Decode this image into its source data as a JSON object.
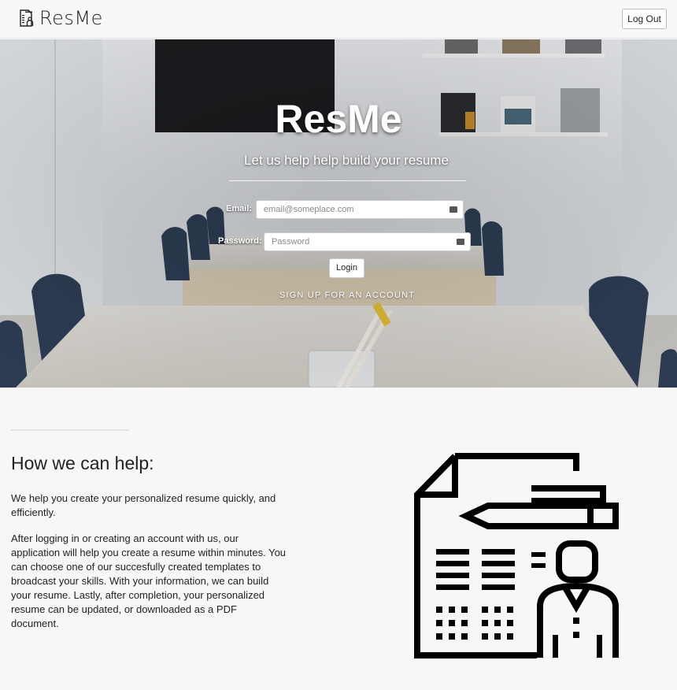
{
  "navbar": {
    "brand": "ResMe",
    "logout_label": "Log Out"
  },
  "hero": {
    "title": "ResMe",
    "subtitle": "Let us help help build your resume",
    "email_label": "Email:",
    "email_placeholder": "email@someplace.com",
    "email_value": "",
    "password_label": "Password:",
    "password_placeholder": "Password",
    "password_value": "",
    "login_label": "Login",
    "signup_label": "SIGN UP FOR AN ACCOUNT"
  },
  "section": {
    "title": "How we can help:",
    "paragraph1": "We help you create your personalized resume quickly, and efficiently.",
    "paragraph2": "After logging in or creating an account with us, our application will help you create a resume within minutes. You can choose one of our succesfully created templates to broadcast your skills. With your information, we can build your resume. Lastly, after completion, your personalized resume can be updated, or downloaded as a PDF document."
  },
  "icons": {
    "brand": "resume-logo-icon",
    "password_manager": "password-manager-key-icon",
    "illustration": "resume-document-person-icon"
  },
  "colors": {
    "page_background": "#f7f7f7",
    "navbar_background": "#f8f8f8",
    "text": "#222222"
  }
}
